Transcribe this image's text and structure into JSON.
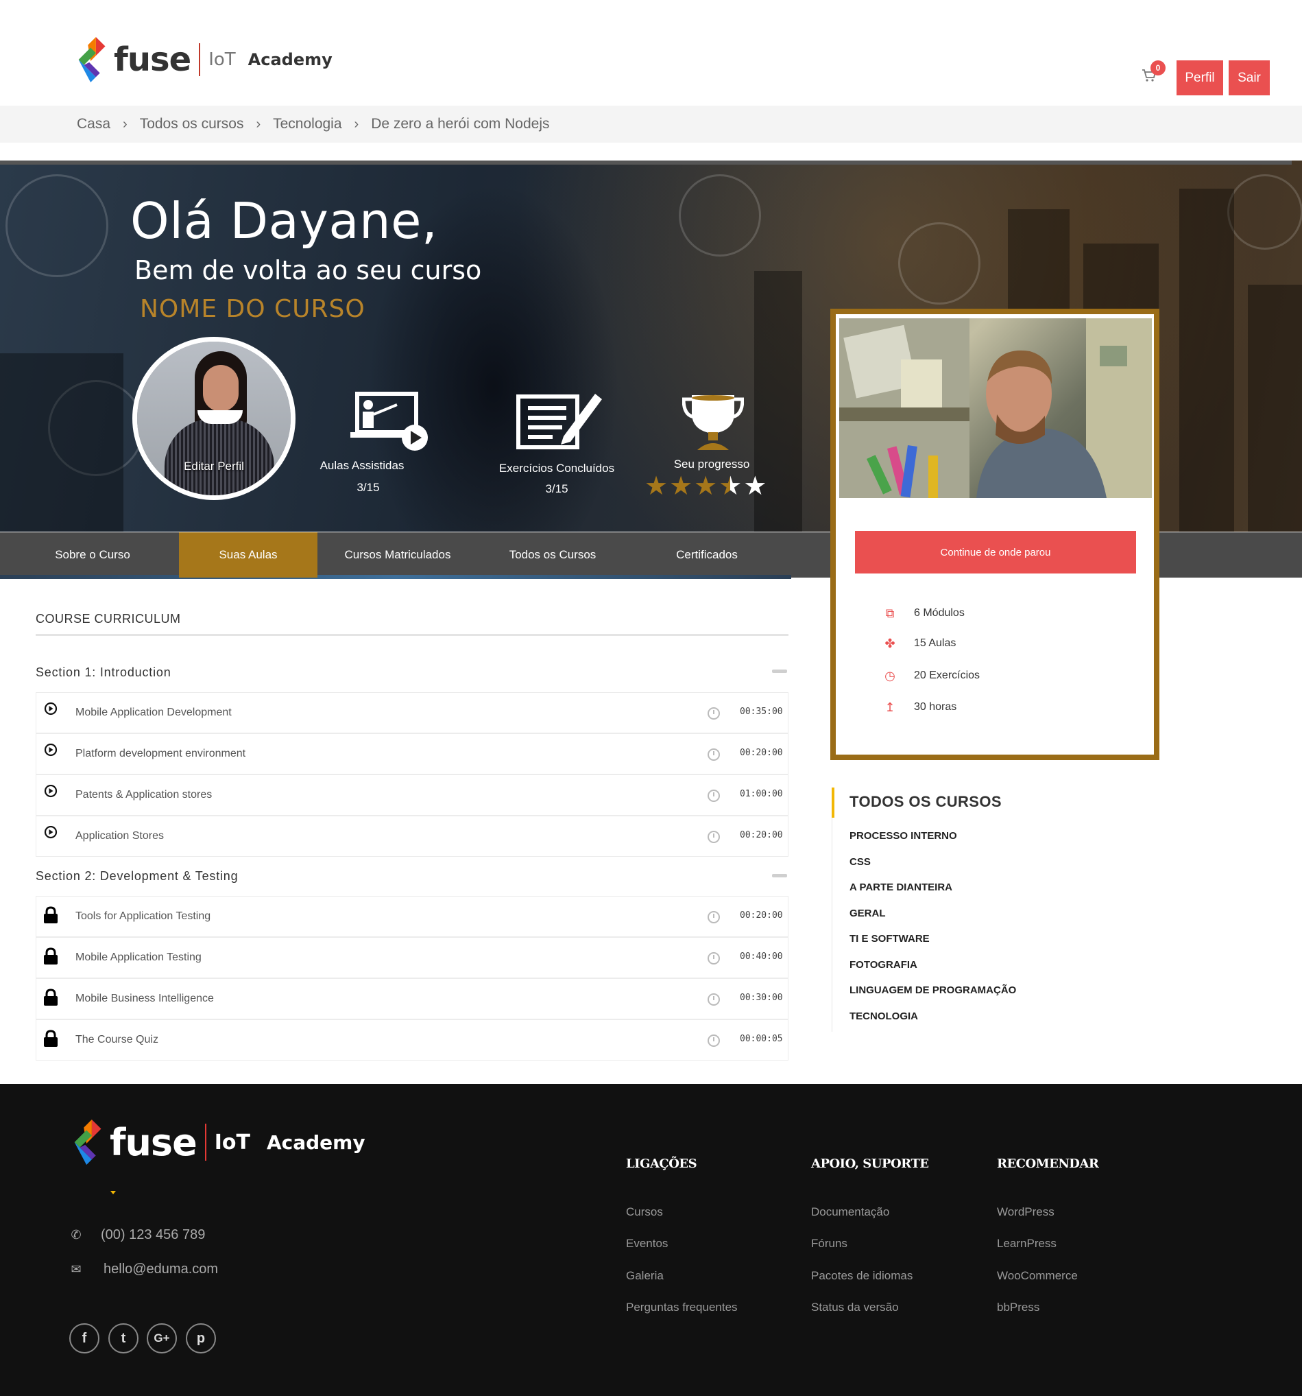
{
  "header": {
    "logo_word": "fuse",
    "logo_iot": "IoT",
    "logo_academy": "Academy",
    "cart_count": "0",
    "profile_label": "Perfil",
    "logout_label": "Sair"
  },
  "breadcrumb": [
    "Casa",
    "Todos os cursos",
    "Tecnologia",
    "De zero a herói com Nodejs"
  ],
  "hero": {
    "greeting": "Olá Dayane,",
    "subtitle": "Bem de volta ao seu curso",
    "course_name": "NOME DO CURSO",
    "edit_profile": "Editar Perfil",
    "stats": [
      {
        "label": "Aulas Assistidas",
        "value": "3/15"
      },
      {
        "label": "Exercícios Concluídos",
        "value": "3/15"
      },
      {
        "label": "Seu progresso",
        "rating": 3.5,
        "max": 5
      }
    ]
  },
  "tabs": [
    "Sobre o Curso",
    "Suas Aulas",
    "Cursos Matriculados",
    "Todos os Cursos",
    "Certificados"
  ],
  "active_tab": "Suas Aulas",
  "curriculum": {
    "title": "COURSE CURRICULUM",
    "sections": [
      {
        "title": "Section 1: Introduction",
        "lessons": [
          {
            "name": "Mobile Application Development",
            "duration": "00:35:00",
            "locked": false
          },
          {
            "name": "Platform development environment",
            "duration": "00:20:00",
            "locked": false
          },
          {
            "name": "Patents & Application stores",
            "duration": "01:00:00",
            "locked": false
          },
          {
            "name": "Application Stores",
            "duration": "00:20:00",
            "locked": false
          }
        ]
      },
      {
        "title": "Section 2: Development & Testing",
        "lessons": [
          {
            "name": "Tools for Application Testing",
            "duration": "00:20:00",
            "locked": true
          },
          {
            "name": "Mobile Application Testing",
            "duration": "00:40:00",
            "locked": true
          },
          {
            "name": "Mobile Business Intelligence",
            "duration": "00:30:00",
            "locked": true
          },
          {
            "name": "The Course Quiz",
            "duration": "00:00:05",
            "locked": true
          }
        ]
      }
    ]
  },
  "course_card": {
    "continue_label": "Continue de onde parou",
    "meta": [
      {
        "icon": "copy-icon",
        "text": "6 Módulos"
      },
      {
        "icon": "puzzle-icon",
        "text": "15 Aulas"
      },
      {
        "icon": "clock-icon",
        "text": "20 Exercícios"
      },
      {
        "icon": "level-icon",
        "text": "30 horas"
      }
    ]
  },
  "categories": {
    "title": "TODOS OS CURSOS",
    "items": [
      "PROCESSO INTERNO",
      "CSS",
      "A PARTE DIANTEIRA",
      "GERAL",
      "TI E SOFTWARE",
      "FOTOGRAFIA",
      "LINGUAGEM DE PROGRAMAÇÃO",
      "TECNOLOGIA"
    ]
  },
  "footer": {
    "phone": "(00) 123 456 789",
    "email": "hello@eduma.com",
    "columns": [
      {
        "title": "LIGAÇÕES",
        "links": [
          "Cursos",
          "Eventos",
          "Galeria",
          "Perguntas frequentes"
        ]
      },
      {
        "title": "APOIO, SUPORTE",
        "links": [
          "Documentação",
          "Fóruns",
          "Pacotes de idiomas",
          "Status da versão"
        ]
      },
      {
        "title": "RECOMENDAR",
        "links": [
          "WordPress",
          "LearnPress",
          "WooCommerce",
          "bbPress"
        ]
      }
    ],
    "social": [
      "facebook-icon",
      "twitter-icon",
      "google-plus-icon",
      "pinterest-icon"
    ]
  },
  "colors": {
    "accent": "#ea5050",
    "gold": "#9a6c17",
    "tab_active": "#a6771a",
    "footer_bg": "#111111"
  }
}
